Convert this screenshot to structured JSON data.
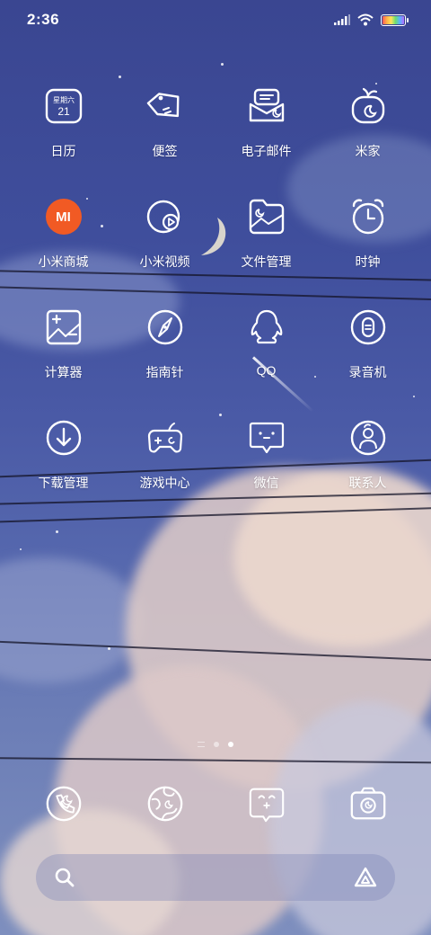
{
  "status_bar": {
    "time": "2:36"
  },
  "apps": [
    {
      "label": "日历",
      "icon": "calendar-icon",
      "sub": "星期六",
      "day": "21"
    },
    {
      "label": "便签",
      "icon": "notes-tag-icon"
    },
    {
      "label": "电子邮件",
      "icon": "email-icon"
    },
    {
      "label": "米家",
      "icon": "mijia-icon"
    },
    {
      "label": "小米商城",
      "icon": "mi-store-icon",
      "logo": "MI"
    },
    {
      "label": "小米视频",
      "icon": "video-play-icon"
    },
    {
      "label": "文件管理",
      "icon": "file-manager-icon"
    },
    {
      "label": "时钟",
      "icon": "clock-icon"
    },
    {
      "label": "计算器",
      "icon": "calculator-icon"
    },
    {
      "label": "指南针",
      "icon": "compass-icon"
    },
    {
      "label": "QQ",
      "icon": "qq-penguin-icon"
    },
    {
      "label": "录音机",
      "icon": "recorder-icon"
    },
    {
      "label": "下载管理",
      "icon": "download-icon"
    },
    {
      "label": "游戏中心",
      "icon": "gamepad-icon"
    },
    {
      "label": "微信",
      "icon": "wechat-chat-icon"
    },
    {
      "label": "联系人",
      "icon": "contacts-icon"
    }
  ],
  "dock": [
    {
      "icon": "phone-icon"
    },
    {
      "icon": "browser-globe-icon"
    },
    {
      "icon": "messages-icon"
    },
    {
      "icon": "camera-icon"
    }
  ],
  "page_indicator": {
    "pages": 3,
    "active": 3
  },
  "colors": {
    "wallpaper_top": "#3a4691",
    "mi_orange": "#f15a24"
  }
}
